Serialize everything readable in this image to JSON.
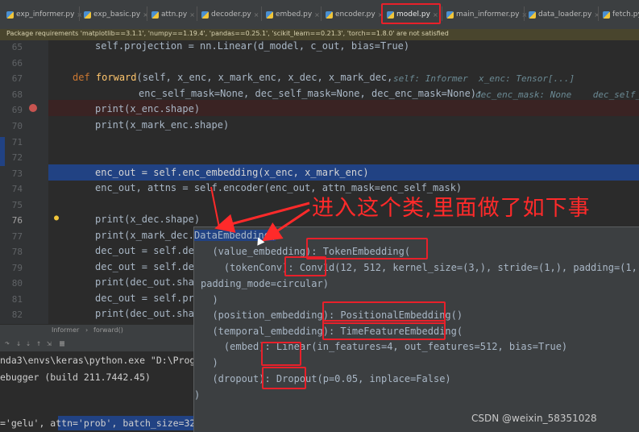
{
  "tabs": [
    {
      "label": "exp_informer.py"
    },
    {
      "label": "exp_basic.py"
    },
    {
      "label": "attn.py"
    },
    {
      "label": "decoder.py"
    },
    {
      "label": "embed.py"
    },
    {
      "label": "encoder.py"
    },
    {
      "label": "model.py",
      "active": true
    },
    {
      "label": "main_informer.py"
    },
    {
      "label": "data_loader.py"
    },
    {
      "label": "fetch.py"
    }
  ],
  "warning": "Package requirements 'matplotlib==3.1.1', 'numpy==1.19.4', 'pandas==0.25.1', 'scikit_learn==0.21.3', 'torch==1.8.0' are not satisfied",
  "line_numbers": [
    "65",
    "66",
    "67",
    "68",
    "69",
    "70",
    "71",
    "72",
    "73",
    "74",
    "75",
    "76",
    "77",
    "78",
    "79",
    "80",
    "81",
    "82"
  ],
  "code": {
    "l65": "self.projection = nn.Linear(d_model, c_out, bias=True)",
    "l67_kw": "def",
    "l67_fn": "forward",
    "l67_rest": "(self, x_enc, x_mark_enc, x_dec, x_mark_dec,",
    "l67_hint": "self: Informer  x_enc: Tensor[...]",
    "l68": "enc_self_mask=None, dec_self_mask=None, dec_enc_mask=None):",
    "l68_hint": "dec_enc_mask: None    dec_self_",
    "l69": "print(x_enc.shape)",
    "l70": "print(x_mark_enc.shape)",
    "l73": "enc_out = self.enc_embedding(x_enc, x_mark_enc)",
    "l74": "enc_out, attns = self.encoder(enc_out, attn_mask=enc_self_mask)",
    "l76": "print(x_dec.shape)",
    "l77": "print(x_mark_dec.s",
    "l78": "dec_out = self.dec",
    "l79": "dec_out = self.dec",
    "l80": "print(dec_out.shap",
    "l81": "dec_out = self.pro",
    "l82": "print(dec_out.shap"
  },
  "breadcrumb": [
    "Informer",
    "forward()"
  ],
  "terminal": {
    "lines": [
      "nda3\\envs\\keras\\python.exe \"D:\\Progr",
      "ebugger (build 211.7442.45)",
      "",
      "='gelu', attn='prob', batch_size=32,"
    ]
  },
  "popup": {
    "lines": [
      "DataEmbedding(",
      "  (value_embedding): TokenEmbedding(",
      "    (tokenConv): Conv1d(12, 512, kernel_size=(3,), stride=(1,), padding=(1,),",
      "padding_mode=circular)",
      "  )",
      "  (position_embedding): PositionalEmbedding()",
      "  (temporal_embedding): TimeFeatureEmbedding(",
      "    (embed): Linear(in_features=4, out_features=512, bias=True)",
      "  )",
      "  (dropout): Dropout(p=0.05, inplace=False)",
      ")"
    ]
  },
  "annotation": "进入这个类,里面做了如下事",
  "watermark": "CSDN @weixin_58351028",
  "colors": {
    "editor_bg": "#2b2b2b",
    "selection": "#214283",
    "annotation_red": "#e8202a",
    "breakpoint": "#c75450"
  },
  "icons": [
    "python-file-icon",
    "close-icon",
    "breakpoint-icon",
    "lightbulb-icon",
    "mouse-cursor-icon"
  ]
}
